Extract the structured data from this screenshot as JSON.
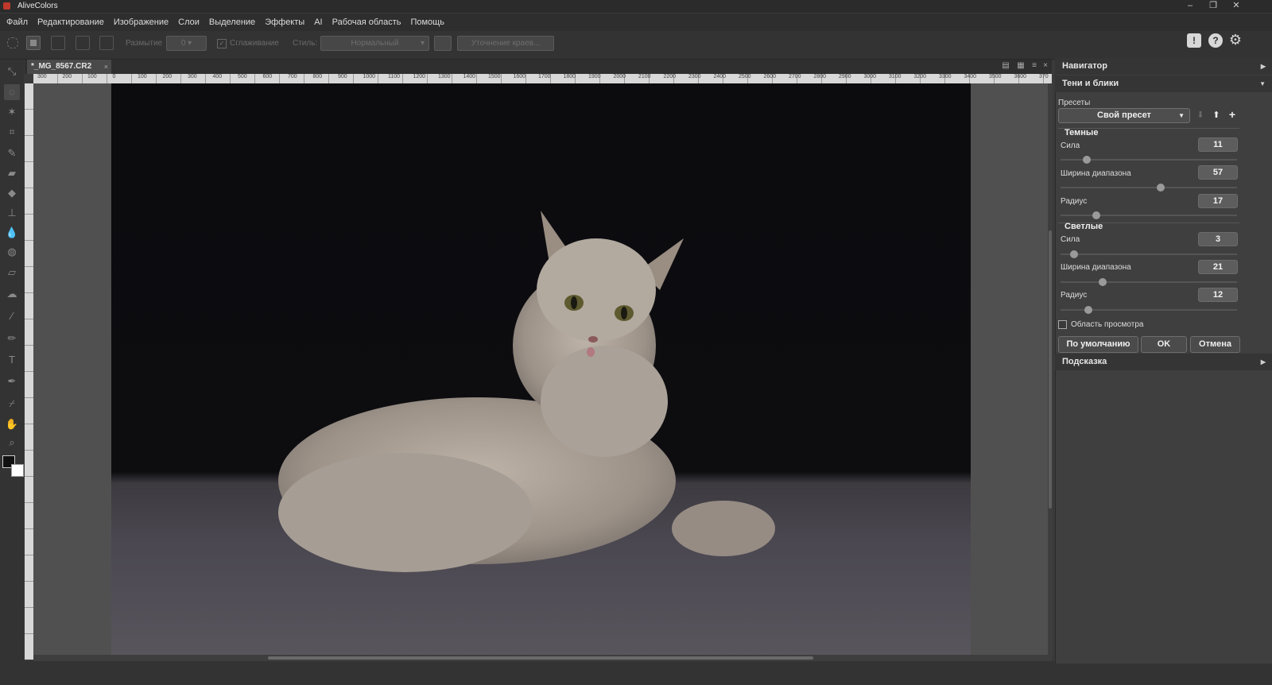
{
  "app": {
    "title": "AliveColors"
  },
  "menu": [
    "Файл",
    "Редактирование",
    "Изображение",
    "Слои",
    "Выделение",
    "Эффекты",
    "AI",
    "Рабочая область",
    "Помощь"
  ],
  "options": {
    "blur_label": "Размытие",
    "blur_value": "0",
    "smooth_label": "Сглаживание",
    "style_label": "Стиль:",
    "style_value": "Нормальный",
    "refine_label": "Уточнение краев..."
  },
  "document": {
    "tab": "*_MG_8567.CR2"
  },
  "ruler": {
    "h_ticks": [
      "300",
      "200",
      "100",
      "0",
      "100",
      "200",
      "300",
      "400",
      "500",
      "600",
      "700",
      "800",
      "900",
      "1000",
      "1100",
      "1200",
      "1300",
      "1400",
      "1500",
      "1600",
      "1700",
      "1800",
      "1900",
      "2000",
      "2100",
      "2200",
      "2300",
      "2400",
      "2500",
      "2600",
      "2700",
      "2800",
      "2900",
      "3000",
      "3100",
      "3200",
      "3300",
      "3400",
      "3500",
      "3600",
      "370"
    ]
  },
  "panel": {
    "navigator": "Навигатор",
    "shadows_highlights": "Тени и блики",
    "presets_label": "Пресеты",
    "preset_value": "Свой пресет",
    "dark_title": "Темные",
    "light_title": "Светлые",
    "dark": [
      {
        "label": "Сила",
        "value": "11",
        "pos": 0.11
      },
      {
        "label": "Ширина диапазона",
        "value": "57",
        "pos": 0.57
      },
      {
        "label": "Радиус",
        "value": "17",
        "pos": 0.17
      }
    ],
    "light": [
      {
        "label": "Сила",
        "value": "3",
        "pos": 0.03
      },
      {
        "label": "Ширина диапазона",
        "value": "21",
        "pos": 0.21
      },
      {
        "label": "Радиус",
        "value": "12",
        "pos": 0.12
      }
    ],
    "preview_label": "Область просмотра",
    "btn_default": "По умолчанию",
    "btn_ok": "OK",
    "btn_cancel": "Отмена",
    "hint": "Подсказка"
  }
}
